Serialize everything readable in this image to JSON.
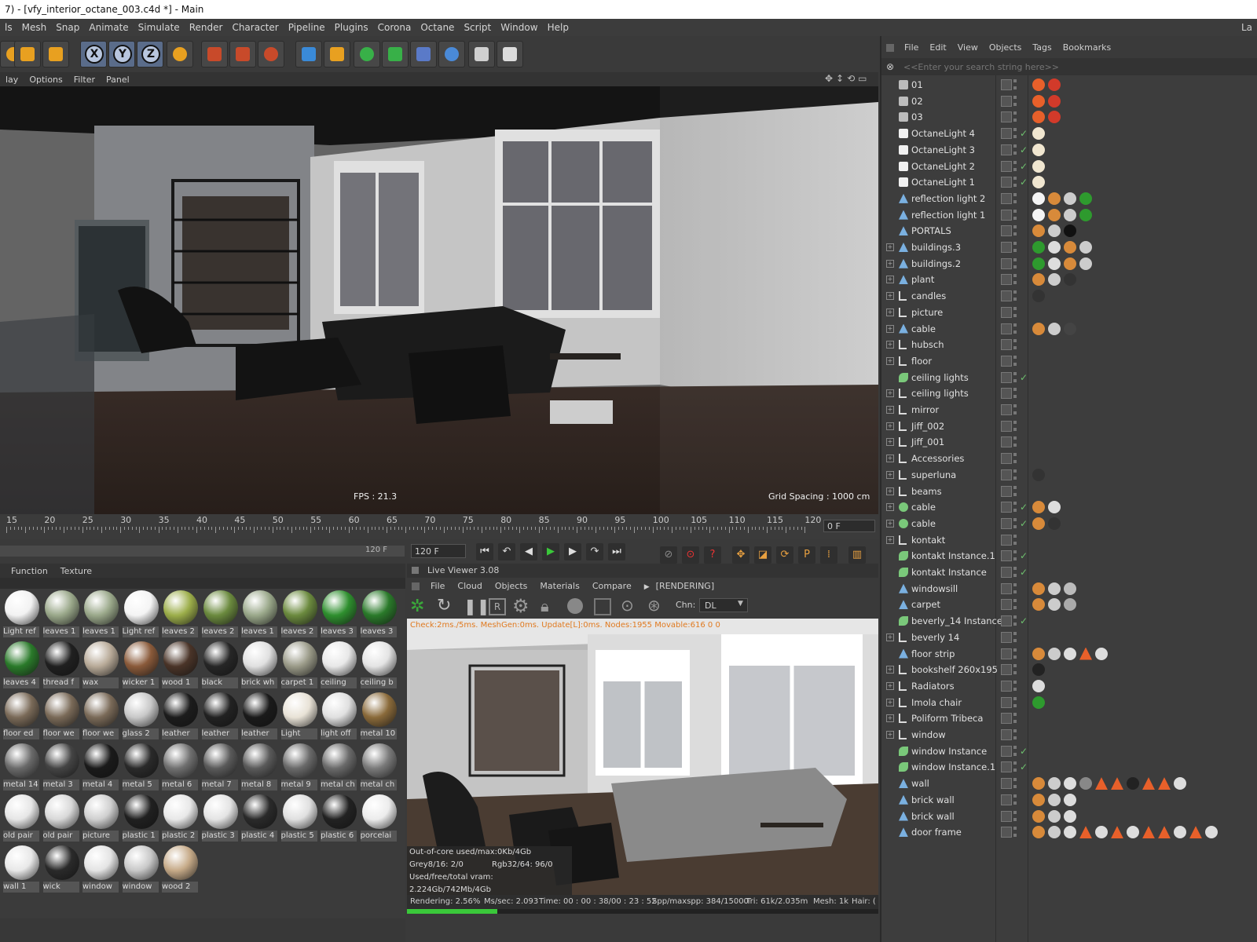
{
  "window_title": "7) - [vfy_interior_octane_003.c4d *] - Main",
  "menu": [
    "ls",
    "Mesh",
    "Snap",
    "Animate",
    "Simulate",
    "Render",
    "Character",
    "Pipeline",
    "Plugins",
    "Corona",
    "Octane",
    "Script",
    "Window",
    "Help"
  ],
  "menu_right": "La",
  "toolbar_icons": [
    "scale-icon",
    "rotate-icon",
    "move-icon",
    "x-axis-icon",
    "y-axis-icon",
    "z-axis-icon",
    "coordinate-system-icon",
    "render-view-icon",
    "render-picture-viewer-icon",
    "render-settings-icon",
    "cube-icon",
    "pen-icon",
    "subdivision-icon",
    "cloner-icon",
    "deformer-icon",
    "floor-icon",
    "camera-icon",
    "light-icon"
  ],
  "axis_labels": [
    "X",
    "Y",
    "Z"
  ],
  "viewport_menu": [
    "lay",
    "Options",
    "Filter",
    "Panel"
  ],
  "viewport": {
    "fps": "FPS : 21.3",
    "grid_spacing": "Grid Spacing : 1000 cm"
  },
  "timeline": {
    "ticks": [
      "15",
      "20",
      "25",
      "30",
      "35",
      "40",
      "45",
      "50",
      "55",
      "60",
      "65",
      "70",
      "75",
      "80",
      "85",
      "90",
      "95",
      "100",
      "105",
      "110",
      "115",
      "120"
    ],
    "current_frame": "0 F",
    "end_frame_left": "120 F",
    "end_frame_right": "120 F"
  },
  "transport_buttons": [
    "go-to-start-icon",
    "previous-key-icon",
    "previous-frame-icon",
    "play-icon",
    "next-frame-icon",
    "next-key-icon",
    "go-to-end-icon"
  ],
  "material_menu": [
    "Function",
    "Texture"
  ],
  "materials": [
    [
      "Light ref",
      "leaves 1",
      "leaves 1",
      "Light ref",
      "leaves 2",
      "leaves 2",
      "leaves 1",
      "leaves 2",
      "leaves 3",
      "leaves 3"
    ],
    [
      "leaves 4",
      "thread f",
      "wax",
      "wicker 1",
      "wood 1",
      "black",
      "brick wh",
      "carpet 1",
      "ceiling",
      "ceiling b"
    ],
    [
      "floor ed",
      "floor we",
      "floor we",
      "glass 2",
      "leather",
      "leather",
      "leather",
      "Light",
      "light off",
      "metal 10"
    ],
    [
      "metal 14",
      "metal 3",
      "metal 4",
      "metal 5",
      "metal 6",
      "metal 7",
      "metal 8",
      "metal 9",
      "metal ch",
      "metal ch"
    ],
    [
      "old pair",
      "old pair",
      "picture",
      "plastic 1",
      "plastic 2",
      "plastic 3",
      "plastic 4",
      "plastic 5",
      "plastic 6",
      "porcelai"
    ],
    [
      "wall 1",
      "wick",
      "window",
      "window",
      "wood 2"
    ]
  ],
  "material_colors": [
    [
      "#f2f2f2",
      "#9aa88a",
      "#9aa88a",
      "#f4f4f4",
      "#9cae4a",
      "#6b8a3e",
      "#9aa88a",
      "#6b8a3e",
      "#2e8f2e",
      "#2a7a2a"
    ],
    [
      "#2a7a2a",
      "#202020",
      "#b8aa98",
      "#8a5a3a",
      "#4a3428",
      "#262626",
      "#e0e0e0",
      "#9a9a88",
      "#e8e8e8",
      "#e4e4e4"
    ],
    [
      "#7a6a58",
      "#7a6a58",
      "#7a6a58",
      "#c8c8c8",
      "#1c1c1c",
      "#222222",
      "#1a1a1a",
      "#e8e2d6",
      "#e0e0e0",
      "#8a6a3a"
    ],
    [
      "#6a6a6a",
      "#444444",
      "#1a1a1a",
      "#2a2a2a",
      "#707070",
      "#5a5a5a",
      "#5a5a5a",
      "#6a6a6a",
      "#6a6a6a",
      "#7a7a7a"
    ],
    [
      "#e6e6e6",
      "#d8d8d8",
      "#cfcfcf",
      "#202020",
      "#e8e8e8",
      "#e4e4e4",
      "#2a2a2a",
      "#e0e0e0",
      "#222222",
      "#ececec"
    ],
    [
      "#e8e8e8",
      "#2a2a2a",
      "#e4e4e4",
      "#c8c8c8",
      "#c6aa88"
    ]
  ],
  "live_viewer": {
    "title": "Live Viewer 3.08",
    "menu": [
      "File",
      "Cloud",
      "Objects",
      "Materials",
      "Compare"
    ],
    "status": "[RENDERING]",
    "channel_label": "Chn:",
    "channel_value": "DL",
    "check_text": "Check:2ms./5ms. MeshGen:0ms. Update[L]:0ms. Nodes:1955 Movable:616  0  0",
    "ooc": "Out-of-core used/max:0Kb/4Gb",
    "grey": "Grey8/16: 2/0",
    "rgb": "Rgb32/64: 96/0",
    "vram": "Used/free/total vram: 2.224Gb/742Mb/4Gb",
    "rendering_label": "Rendering: 2.56%",
    "ms_sec": "Ms/sec: 2.093",
    "time": "Time: 00 : 00 : 38/00 : 23 : 52",
    "spp": "Spp/maxspp: 384/15000",
    "tri": "Tri: 61k/2.035m",
    "mesh": "Mesh: 1k",
    "hair": "Hair: (",
    "progress": 0.0256
  },
  "object_manager": {
    "menu": [
      "File",
      "Edit",
      "View",
      "Objects",
      "Tags",
      "Bookmarks"
    ],
    "search_placeholder": "<<Enter your search string here>>",
    "rows": [
      {
        "name": "01",
        "icon": "camera",
        "exp": false,
        "check": false,
        "tags": [
          "#e8602a",
          "#d23a2a"
        ]
      },
      {
        "name": "02",
        "icon": "camera",
        "exp": false,
        "check": false,
        "tags": [
          "#e8602a",
          "#d23a2a"
        ]
      },
      {
        "name": "03",
        "icon": "camera",
        "exp": false,
        "check": false,
        "tags": [
          "#e8602a",
          "#d23a2a"
        ]
      },
      {
        "name": "OctaneLight 4",
        "icon": "light",
        "exp": false,
        "check": true,
        "tags": [
          "#f0e6d0"
        ]
      },
      {
        "name": "OctaneLight 3",
        "icon": "light",
        "exp": false,
        "check": true,
        "tags": [
          "#f0e6d0"
        ]
      },
      {
        "name": "OctaneLight 2",
        "icon": "light",
        "exp": false,
        "check": true,
        "tags": [
          "#f0e6d0"
        ]
      },
      {
        "name": "OctaneLight 1",
        "icon": "light",
        "exp": false,
        "check": true,
        "tags": [
          "#f0e6d0"
        ]
      },
      {
        "name": "reflection light 2",
        "icon": "poly",
        "exp": false,
        "check": false,
        "tags": [
          "#f4f4f4",
          "#d88a3a",
          "#cccccc",
          "#2e9a2e"
        ]
      },
      {
        "name": "reflection light 1",
        "icon": "poly",
        "exp": false,
        "check": false,
        "tags": [
          "#f4f4f4",
          "#d88a3a",
          "#cccccc",
          "#2e9a2e"
        ]
      },
      {
        "name": "PORTALS",
        "icon": "poly",
        "exp": false,
        "check": false,
        "tags": [
          "#d88a3a",
          "#cccccc",
          "#111111"
        ]
      },
      {
        "name": "buildings.3",
        "icon": "poly",
        "exp": true,
        "check": false,
        "tags": [
          "#2e9a2e",
          "#dddddd",
          "#d88a3a",
          "#cccccc"
        ]
      },
      {
        "name": "buildings.2",
        "icon": "poly",
        "exp": true,
        "check": false,
        "tags": [
          "#2e9a2e",
          "#dddddd",
          "#d88a3a",
          "#cccccc"
        ]
      },
      {
        "name": "plant",
        "icon": "poly",
        "exp": true,
        "check": false,
        "tags": [
          "#d88a3a",
          "#cccccc",
          "#333333"
        ]
      },
      {
        "name": "candles",
        "icon": "null",
        "exp": true,
        "check": false,
        "tags": [
          "#333333"
        ]
      },
      {
        "name": "picture",
        "icon": "null",
        "exp": true,
        "check": false,
        "tags": []
      },
      {
        "name": "cable",
        "icon": "poly",
        "exp": true,
        "check": false,
        "tags": [
          "#d88a3a",
          "#cccccc",
          "#444444"
        ]
      },
      {
        "name": "hubsch",
        "icon": "null",
        "exp": true,
        "check": false,
        "tags": []
      },
      {
        "name": "floor",
        "icon": "null",
        "exp": true,
        "check": false,
        "tags": []
      },
      {
        "name": "ceiling lights",
        "icon": "instance",
        "exp": false,
        "check": true,
        "tags": []
      },
      {
        "name": "ceiling lights",
        "icon": "null",
        "exp": true,
        "check": false,
        "tags": []
      },
      {
        "name": "mirror",
        "icon": "null",
        "exp": true,
        "check": false,
        "tags": []
      },
      {
        "name": "Jiff_002",
        "icon": "null",
        "exp": true,
        "check": false,
        "tags": []
      },
      {
        "name": "Jiff_001",
        "icon": "null",
        "exp": true,
        "check": false,
        "tags": []
      },
      {
        "name": "Accessories",
        "icon": "null",
        "exp": true,
        "check": false,
        "tags": []
      },
      {
        "name": "superluna",
        "icon": "null",
        "exp": true,
        "check": false,
        "tags": [
          "#333333"
        ]
      },
      {
        "name": "beams",
        "icon": "null",
        "exp": true,
        "check": false,
        "tags": []
      },
      {
        "name": "cable",
        "icon": "spline",
        "exp": true,
        "check": true,
        "tags": [
          "#d88a3a",
          "#dddddd"
        ]
      },
      {
        "name": "cable",
        "icon": "spline",
        "exp": true,
        "check": true,
        "tags": [
          "#d88a3a",
          "#333333"
        ]
      },
      {
        "name": "kontakt",
        "icon": "null",
        "exp": true,
        "check": false,
        "tags": []
      },
      {
        "name": "kontakt Instance.1",
        "icon": "instance",
        "exp": false,
        "check": true,
        "tags": []
      },
      {
        "name": "kontakt Instance",
        "icon": "instance",
        "exp": false,
        "check": true,
        "tags": []
      },
      {
        "name": "windowsill",
        "icon": "poly",
        "exp": false,
        "check": false,
        "tags": [
          "#d88a3a",
          "#cccccc",
          "#bbbbbb"
        ]
      },
      {
        "name": "carpet",
        "icon": "poly",
        "exp": false,
        "check": false,
        "tags": [
          "#d88a3a",
          "#cccccc",
          "#aaaaaa"
        ]
      },
      {
        "name": "beverly_14 Instance",
        "icon": "instance",
        "exp": false,
        "check": true,
        "tags": []
      },
      {
        "name": "beverly 14",
        "icon": "null",
        "exp": true,
        "check": false,
        "tags": []
      },
      {
        "name": "floor strip",
        "icon": "poly",
        "exp": false,
        "check": false,
        "tags": [
          "#d88a3a",
          "#cccccc",
          "#dddddd",
          "#e8602a",
          "#dddddd"
        ]
      },
      {
        "name": "bookshelf 260x195",
        "icon": "null",
        "exp": true,
        "check": false,
        "tags": [
          "#222222"
        ]
      },
      {
        "name": "Radiators",
        "icon": "null",
        "exp": true,
        "check": false,
        "tags": [
          "#dddddd"
        ]
      },
      {
        "name": "Imola chair",
        "icon": "null",
        "exp": true,
        "check": false,
        "tags": [
          "#2e9a2e"
        ]
      },
      {
        "name": "Poliform Tribeca",
        "icon": "null",
        "exp": true,
        "check": false,
        "tags": []
      },
      {
        "name": "window",
        "icon": "null",
        "exp": true,
        "check": false,
        "tags": []
      },
      {
        "name": "window Instance",
        "icon": "instance",
        "exp": false,
        "check": true,
        "tags": []
      },
      {
        "name": "window Instance.1",
        "icon": "instance",
        "exp": false,
        "check": true,
        "tags": []
      },
      {
        "name": "wall",
        "icon": "poly",
        "exp": false,
        "check": false,
        "tags": [
          "#d88a3a",
          "#cccccc",
          "#dddddd",
          "#888888",
          "#e8602a",
          "#e8602a",
          "#222222",
          "#e8602a",
          "#e8602a",
          "#dddddd"
        ]
      },
      {
        "name": "brick wall",
        "icon": "poly",
        "exp": false,
        "check": false,
        "tags": [
          "#d88a3a",
          "#cccccc",
          "#dddddd"
        ]
      },
      {
        "name": "brick wall",
        "icon": "poly",
        "exp": false,
        "check": false,
        "tags": [
          "#d88a3a",
          "#cccccc",
          "#dddddd"
        ]
      },
      {
        "name": "door frame",
        "icon": "poly",
        "exp": false,
        "check": false,
        "tags": [
          "#d88a3a",
          "#cccccc",
          "#dddddd",
          "#e8602a",
          "#dddddd",
          "#e8602a",
          "#dddddd",
          "#e8602a",
          "#e8602a",
          "#dddddd",
          "#e8602a",
          "#dddddd"
        ]
      }
    ]
  }
}
